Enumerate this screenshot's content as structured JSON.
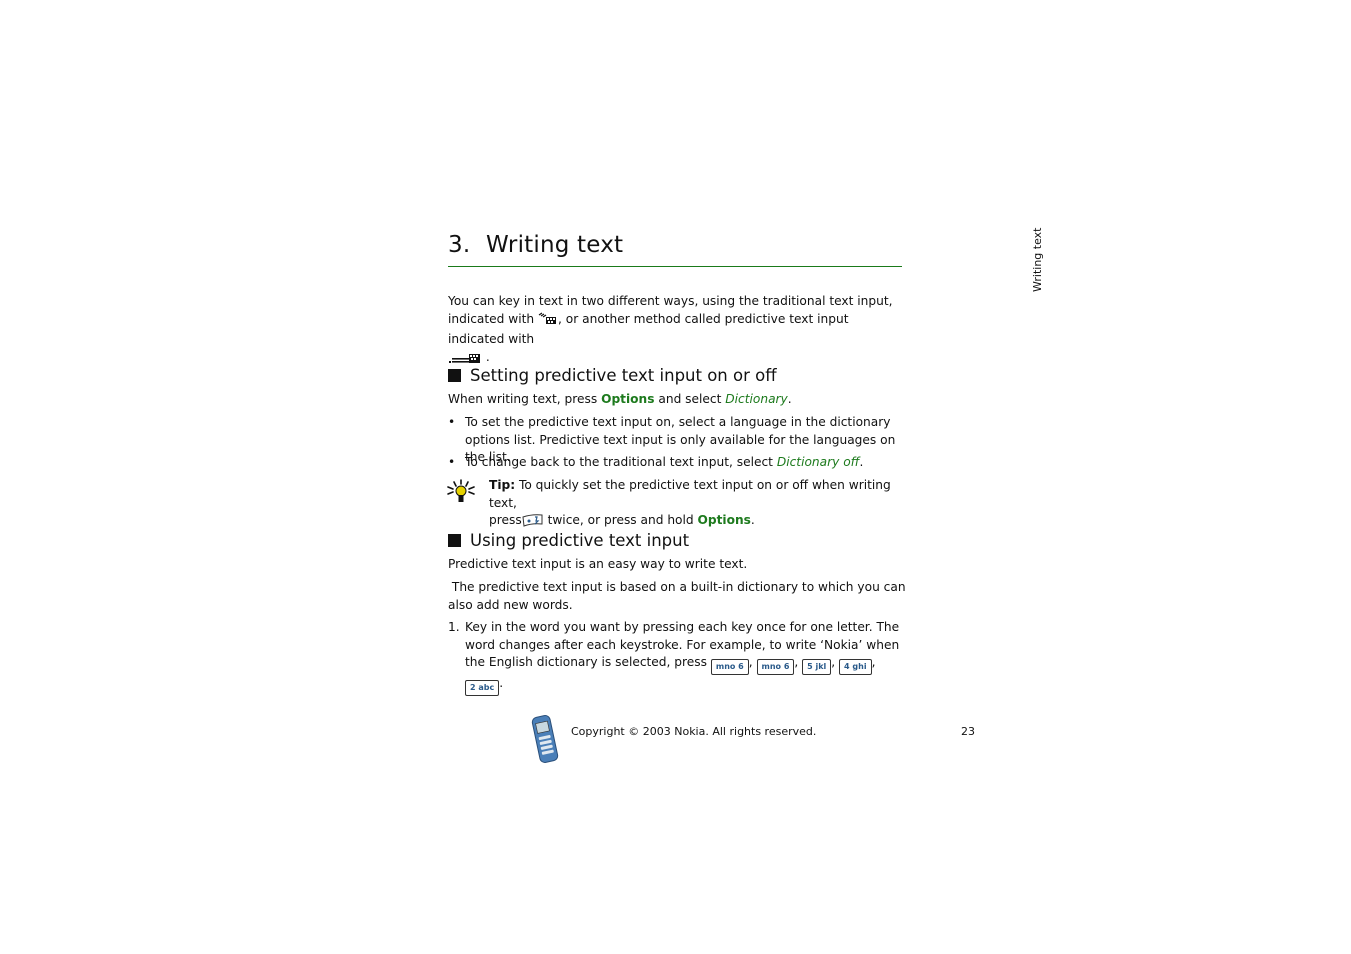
{
  "side_label": "Writing text",
  "chapter": {
    "number": "3.",
    "title": "Writing text"
  },
  "intro": {
    "line1": "You can key in text in two different ways, using the traditional text input,",
    "line2_a": "indicated with",
    "line2_b": ", or another method called predictive text input indicated with",
    "line3_end": ".",
    "icons": [
      "traditional-text-input-icon",
      "predictive-text-input-icon"
    ]
  },
  "section1": {
    "heading": "Setting predictive text input on or off",
    "instruction_a": "When writing text, press",
    "instruction_options": "Options",
    "instruction_b": "and select",
    "instruction_dictionary": "Dictionary",
    "instruction_end": ".",
    "bullets": [
      {
        "text": "To set the predictive text input on, select a language in the dictionary options list. Predictive text input is only available for the languages on the list."
      },
      {
        "text_a": "To change back to the traditional text input, select",
        "link": "Dictionary off",
        "text_end": "."
      }
    ],
    "tip": {
      "label": "Tip:",
      "text_a": "To quickly set the predictive text input on or off when writing text,",
      "text_b_press": "press",
      "key": "edit-key",
      "text_c": "twice, or press and hold",
      "options": "Options",
      "text_end": "."
    }
  },
  "section2": {
    "heading": "Using predictive text input",
    "para1": "Predictive text input is an easy way to write text.",
    "para2": " The predictive text input is based on a built-in dictionary to which you can also add new words.",
    "steps": [
      {
        "number": "1.",
        "text_a": "Key in the word you want by pressing each key once for one letter. The word changes after each keystroke. For example, to write ‘Nokia’ when the English dictionary is selected, press",
        "keys": [
          "mno 6",
          "mno 6",
          "5 jkl",
          "4 ghi",
          "2 abc"
        ],
        "separator": ",",
        "text_end": "."
      }
    ]
  },
  "footer": {
    "copyright": "Copyright © 2003 Nokia. All rights reserved.",
    "page_number": "23"
  },
  "colors": {
    "accent_green": "#1d7a1d",
    "key_blue": "#2a5a8a"
  }
}
